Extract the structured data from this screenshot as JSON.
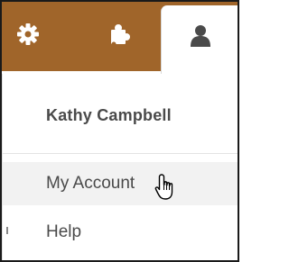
{
  "tabs": [
    {
      "icon": "gear-icon",
      "active": false
    },
    {
      "icon": "puzzle-icon",
      "active": false
    },
    {
      "icon": "user-icon",
      "active": true
    }
  ],
  "colors": {
    "tab_bar": "#a0652a",
    "icon_light": "#ffffff",
    "icon_dark": "#4a4a4a",
    "hover_bg": "#f2f2f2",
    "text": "#4a4a4a"
  },
  "user_menu": {
    "user_name": "Kathy Campbell",
    "items": [
      {
        "label": "My Account",
        "hovered": true
      },
      {
        "label": "Help",
        "hovered": false
      }
    ]
  }
}
